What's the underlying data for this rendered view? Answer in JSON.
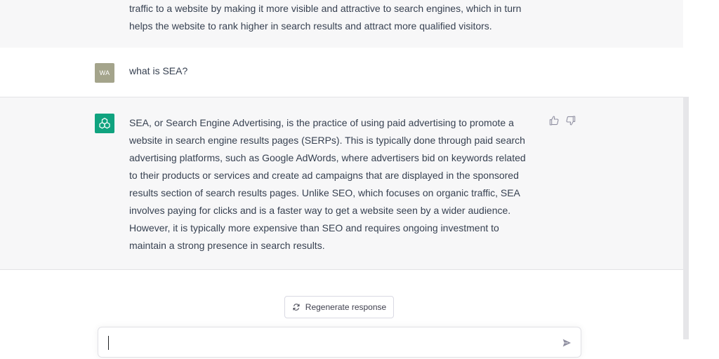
{
  "conversation": {
    "previous_bot_message": {
      "lines": [
        "traffic to a website by making it more visible and attractive to search engines, which in turn",
        "helps the website to rank higher in search results and attract more qualified visitors."
      ]
    },
    "user_message": {
      "avatar_initials": "WA",
      "text": "what is SEA?"
    },
    "bot_message": {
      "avatar_icon": "openai-logo-icon",
      "lines": [
        "SEA, or Search Engine Advertising, is the practice of using paid advertising to promote a",
        "website in search engine results pages (SERPs). This is typically done through paid search",
        "advertising platforms, such as Google AdWords, where advertisers bid on keywords related",
        "to their products or services and create ad campaigns that are displayed in the sponsored",
        "results section of search results pages. Unlike SEO, which focuses on organic traffic, SEA",
        "involves paying for clicks and is a faster way to get a website seen by a wider audience.",
        "However, it is typically more expensive than SEO and requires ongoing investment to",
        "maintain a strong presence in search results."
      ],
      "feedback_icons": [
        "thumbs-up-icon",
        "thumbs-down-icon"
      ]
    }
  },
  "controls": {
    "regenerate_label": "Regenerate response",
    "regenerate_icon": "refresh-icon",
    "input_value": "",
    "send_icon": "send-icon"
  },
  "colors": {
    "bot_background": "#f7f7f8",
    "user_avatar": "#a4a48b",
    "bot_avatar": "#10a37f",
    "text": "#374151"
  }
}
